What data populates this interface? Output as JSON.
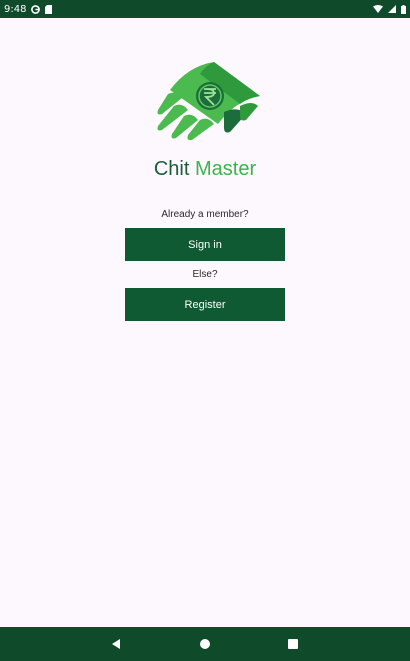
{
  "status_bar": {
    "time": "9:48",
    "icons": [
      "google-icon",
      "sd-card-icon",
      "wifi-icon",
      "cellular-icon",
      "battery-icon"
    ]
  },
  "app": {
    "name_part1": "Chit",
    "name_part2": "Master",
    "logo": "rupee-money-logo",
    "brand_colors": {
      "dark_green": "#1b5e3a",
      "light_green": "#3cb44b",
      "button_green": "#0f5a33",
      "bar_green": "#0f4a2b"
    }
  },
  "auth": {
    "member_prompt": "Already a member?",
    "signin_label": "Sign in",
    "else_prompt": "Else?",
    "register_label": "Register"
  },
  "nav_bar": {
    "icons": [
      "back-icon",
      "home-icon",
      "recents-icon"
    ]
  }
}
